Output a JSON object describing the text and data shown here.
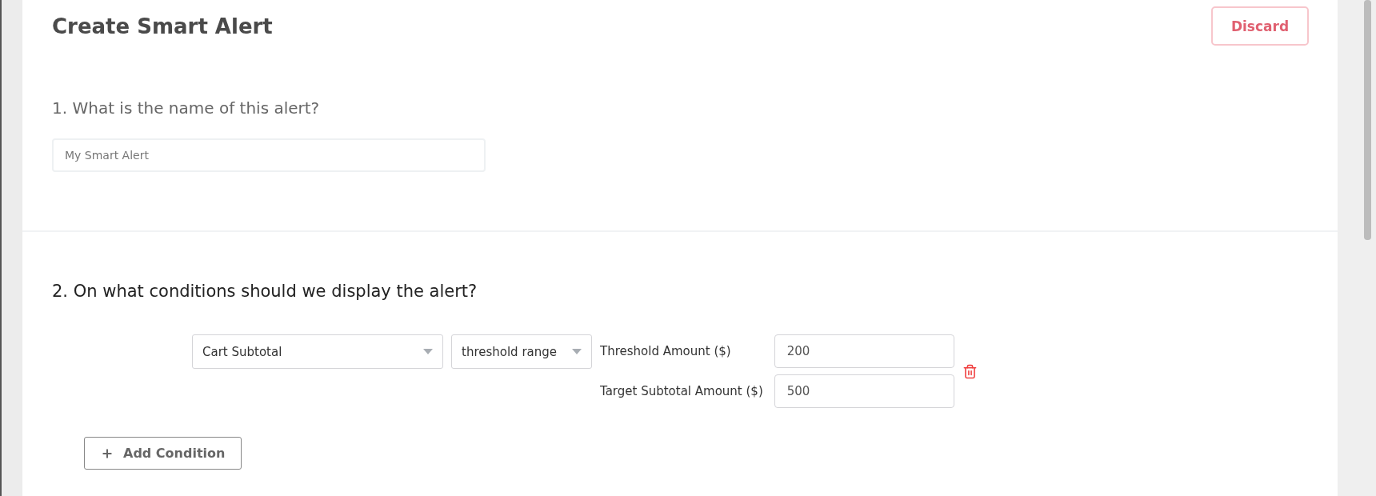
{
  "header": {
    "title": "Create Smart Alert",
    "discard_button": "Discard"
  },
  "name_section": {
    "question": "1. What is the name of this alert?",
    "name_field": {
      "placeholder": "My Smart Alert"
    }
  },
  "conditions_section": {
    "question": "2. On what conditions should we display the alert?",
    "conditions": [
      {
        "field": "Cart Subtotal",
        "operator": "threshold range",
        "inputs": [
          {
            "label": "Threshold Amount ($)",
            "value": "200"
          },
          {
            "label": "Target Subtotal Amount ($)",
            "value": "500"
          }
        ]
      }
    ],
    "add_button": "Add Condition"
  }
}
